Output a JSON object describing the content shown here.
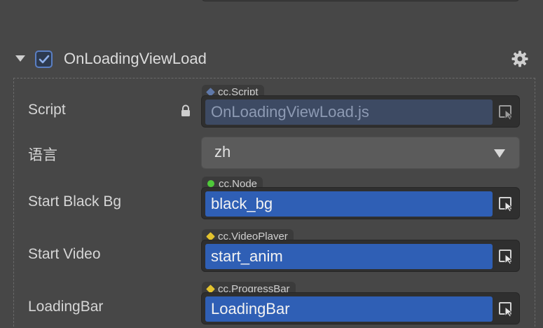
{
  "component": {
    "title": "OnLoadingViewLoad",
    "enabled": true
  },
  "rows": {
    "script": {
      "label": "Script",
      "type_tag": "cc.Script",
      "value": "OnLoadingViewLoad.js",
      "locked": true
    },
    "language": {
      "label": "语言",
      "value": "zh"
    },
    "start_black_bg": {
      "label": "Start Black Bg",
      "type_tag": "cc.Node",
      "value": "black_bg"
    },
    "start_video": {
      "label": "Start Video",
      "type_tag": "cc.VideoPlayer",
      "value": "start_anim"
    },
    "loading_bar": {
      "label": "LoadingBar",
      "type_tag": "cc.ProgressBar",
      "value": "LoadingBar"
    }
  },
  "colors": {
    "node_dot": "#4fc93a",
    "component_dot": "#e3c32e",
    "script_dot": "#5f78a8",
    "field_active": "#2f5fb5",
    "field_disabled": "#3d4a63"
  },
  "icons": {
    "gear": "gear-icon",
    "lock": "lock-icon",
    "pick": "pick-target-icon",
    "caret": "caret-down-icon",
    "dropdown": "chevron-down-icon"
  }
}
